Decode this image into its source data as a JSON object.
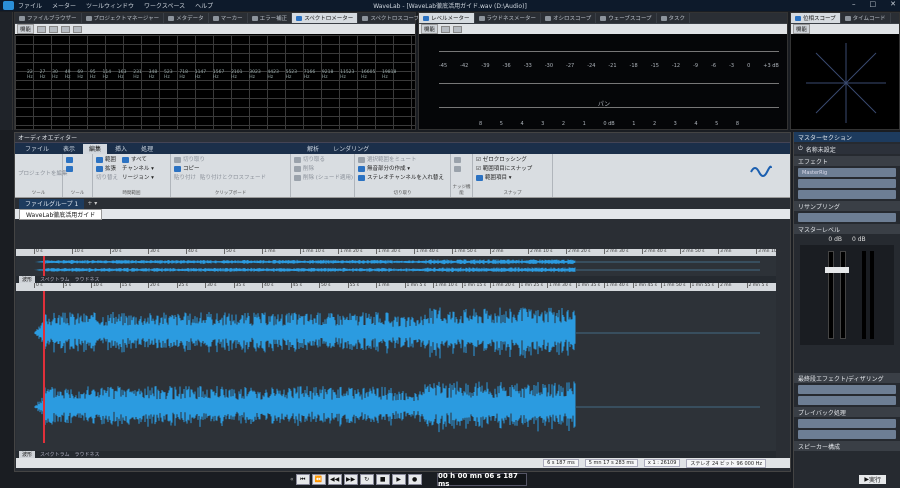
{
  "app": {
    "title": "WaveLab - [WaveLab徹底活用ガイド.wav (D:\\Audio)]",
    "menu": [
      "ファイル",
      "メーター",
      "ツールウィンドウ",
      "ワークスペース",
      "ヘルプ"
    ]
  },
  "top_tabs": [
    "ファイルブラウザー",
    "プロジェクトマネージャー",
    "メタデータ",
    "マーカー",
    "エラー補正",
    "スペクトロメーター",
    "スペクトロスコープ"
  ],
  "active_top_tab": "スペクトロメーター",
  "meter_tabs": [
    "レベルメーター",
    "ラウドネスメーター",
    "オシロスコープ",
    "ウェーブスコープ",
    "タスク"
  ],
  "active_meter_tab": "レベルメーター",
  "phase_tabs": [
    "位相スコープ",
    "タイムコード"
  ],
  "meter_label": "機能",
  "spectro_freqs": [
    "22 Hz",
    "27 Hz",
    "30 Hz",
    "49 Hz",
    "69 Hz",
    "95 Hz",
    "114 Hz",
    "163 Hz",
    "231 Hz",
    "348 Hz",
    "523 Hz",
    "718 Hz",
    "1147 Hz",
    "1567 Hz",
    "2101 Hz",
    "3023 Hz",
    "4423 Hz",
    "5523 Hz",
    "7166 Hz",
    "9218 Hz",
    "11523 Hz",
    "16605 Hz",
    "19818 Hz"
  ],
  "level_scale": [
    "-45",
    "-42",
    "-39",
    "-36",
    "-33",
    "-30",
    "-27",
    "-24",
    "-21",
    "-18",
    "-15",
    "-12",
    "-9",
    "-6",
    "-3",
    "0",
    "+3 dB"
  ],
  "level_pan": "パン",
  "level_pan_scale": [
    "8",
    "5",
    "4",
    "3",
    "2",
    "1",
    "0 dB",
    "1",
    "2",
    "3",
    "4",
    "5",
    "8"
  ],
  "editor": {
    "title": "オーディオエディター",
    "ribbon_tabs": [
      "ファイル",
      "表示",
      "編集",
      "挿入",
      "処理",
      "解析",
      "レンダリング"
    ],
    "active_ribbon_tab": "編集",
    "groups": [
      {
        "name": "ツール",
        "items": [
          "プロジェクトを編集"
        ]
      },
      {
        "name": "ツール",
        "items": [
          "",
          ""
        ]
      },
      {
        "name": "時間範囲",
        "items": [
          "範囲",
          "拡張",
          "切り替え",
          "すべて",
          "チャンネル",
          "リージョン"
        ]
      },
      {
        "name": "クリップボード",
        "items": [
          "切り取り",
          "コピー",
          "貼り付け",
          "貼り付けとクロスフェード"
        ]
      },
      {
        "name": "",
        "items": [
          "切り取る",
          "削除",
          "削除 (シュード適用)"
        ]
      },
      {
        "name": "切り取り",
        "items": [
          "選択範囲をミュート",
          "無音部分の作成",
          "ステレオチャンネルを入れ替え"
        ]
      },
      {
        "name": "ナッジ機能",
        "items": [
          "",
          ""
        ]
      },
      {
        "name": "スナップ",
        "items": [
          "ゼロクロッシング",
          "範囲項目にスナップ",
          "範囲項目"
        ]
      }
    ]
  },
  "file_group": "ファイルグループ 1",
  "doc_tab": "WaveLab徹底活用ガイド",
  "view_tabs": [
    "波形",
    "スペクトラム",
    "ラウドネス"
  ],
  "overview_ticks": [
    "0 s",
    "10 s",
    "20 s",
    "30 s",
    "40 s",
    "50 s",
    "1 mn",
    "1 mn 10 s",
    "1 mn 20 s",
    "1 mn 30 s",
    "1 mn 40 s",
    "1 mn 50 s",
    "2 mn",
    "2 mn 10 s",
    "2 mn 20 s",
    "2 mn 30 s",
    "2 mn 40 s",
    "2 mn 50 s",
    "3 mn",
    "3 mn 10 s"
  ],
  "main_ticks": [
    "0 s",
    "5 s",
    "10 s",
    "15 s",
    "20 s",
    "25 s",
    "30 s",
    "35 s",
    "40 s",
    "45 s",
    "50 s",
    "55 s",
    "1 mn",
    "1 mn 5 s",
    "1 mn 10 s",
    "1 mn 15 s",
    "1 mn 20 s",
    "1 mn 25 s",
    "1 mn 30 s",
    "1 mn 35 s",
    "1 mn 40 s",
    "1 mn 45 s",
    "1 mn 50 s",
    "1 mn 55 s",
    "2 mn",
    "2 mn 5 s"
  ],
  "status": {
    "cursor": "6 s 187 ms",
    "length": "5 mn 17 s 283 ms",
    "zoom": "x 1 : 26109",
    "format": "ステレオ 24 ビット 96 000 Hz"
  },
  "master": {
    "title": "マスターセクション",
    "preset": "名称未設定",
    "sections": [
      "エフェクト",
      "リサンプリング",
      "マスターレベル",
      "最終段エフェクト/ディザリング",
      "プレイバック処理",
      "スピーカー構成"
    ],
    "effect_slot": "MasterRig",
    "level_values": [
      "0 dB",
      "0 dB"
    ],
    "render_btn": "実行"
  },
  "transport": {
    "time": "00 h 00 mn 06 s 187 ms"
  },
  "colors": {
    "wave": "#2b9be0",
    "cursor": "#e0303a",
    "accent": "#2b72c2"
  }
}
